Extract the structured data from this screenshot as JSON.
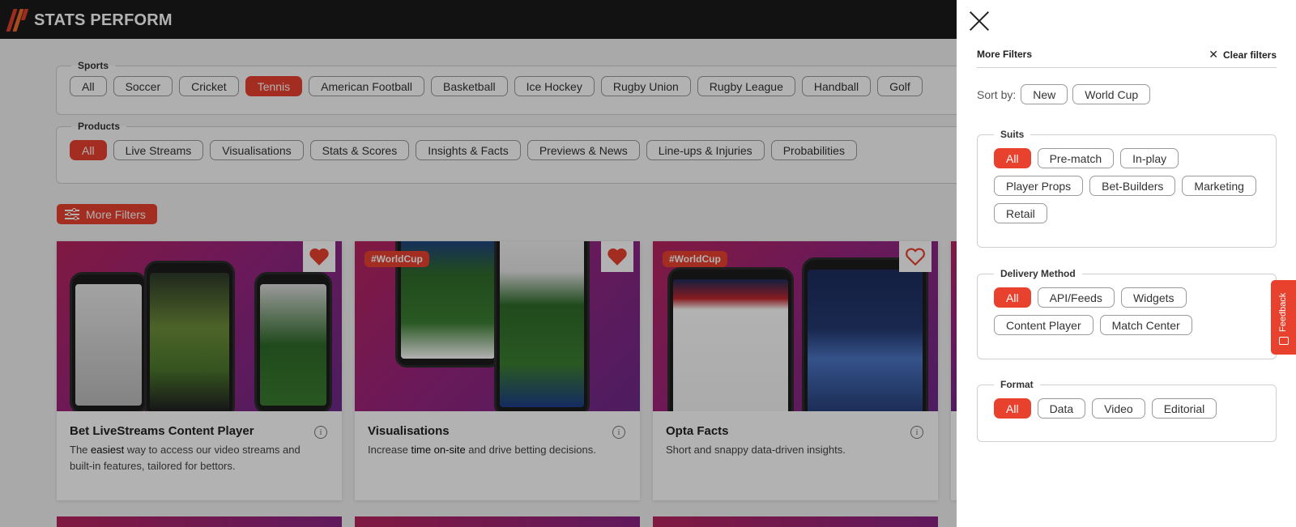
{
  "brand": {
    "name": "STATS PERFORM"
  },
  "sports": {
    "legend": "Sports",
    "items": [
      "All",
      "Soccer",
      "Cricket",
      "Tennis",
      "American Football",
      "Basketball",
      "Ice Hockey",
      "Rugby Union",
      "Rugby League",
      "Handball",
      "Golf"
    ],
    "selected": "Tennis"
  },
  "products": {
    "legend": "Products",
    "items": [
      "All",
      "Live Streams",
      "Visualisations",
      "Stats & Scores",
      "Insights & Facts",
      "Previews & News",
      "Line-ups & Injuries",
      "Probabilities"
    ],
    "selected": "All"
  },
  "more_filters_button": "More Filters",
  "cards": [
    {
      "title": "Bet LiveStreams Content Player",
      "desc_pre": "The ",
      "desc_em": "easiest",
      "desc_post": " way to access our video streams and built-in features, tailored for bettors.",
      "tag": "",
      "favorited": true
    },
    {
      "title": "Visualisations",
      "desc_pre": "Increase ",
      "desc_em": "time on-site",
      "desc_post": " and drive betting decisions.",
      "tag": "#WorldCup",
      "favorited": true
    },
    {
      "title": "Opta Facts",
      "desc_pre": "Short and snappy data-driven insights.",
      "desc_em": "",
      "desc_post": "",
      "tag": "#WorldCup",
      "favorited": false
    }
  ],
  "drawer": {
    "title": "More Filters",
    "clear_filters": "Clear filters",
    "sort_label": "Sort by:",
    "sort_options": [
      "New",
      "World Cup"
    ],
    "suits": {
      "legend": "Suits",
      "items": [
        "All",
        "Pre-match",
        "In-play",
        "Player Props",
        "Bet-Builders",
        "Marketing",
        "Retail"
      ],
      "selected": "All"
    },
    "delivery": {
      "legend": "Delivery Method",
      "items": [
        "All",
        "API/Feeds",
        "Widgets",
        "Content Player",
        "Match Center"
      ],
      "selected": "All"
    },
    "format": {
      "legend": "Format",
      "items": [
        "All",
        "Data",
        "Video",
        "Editorial"
      ],
      "selected": "All"
    }
  },
  "feedback_tab": "Feedback",
  "colors": {
    "accent": "#e8412e",
    "header_bg": "#1b1b1b",
    "card_gradient": "#b8245e"
  }
}
